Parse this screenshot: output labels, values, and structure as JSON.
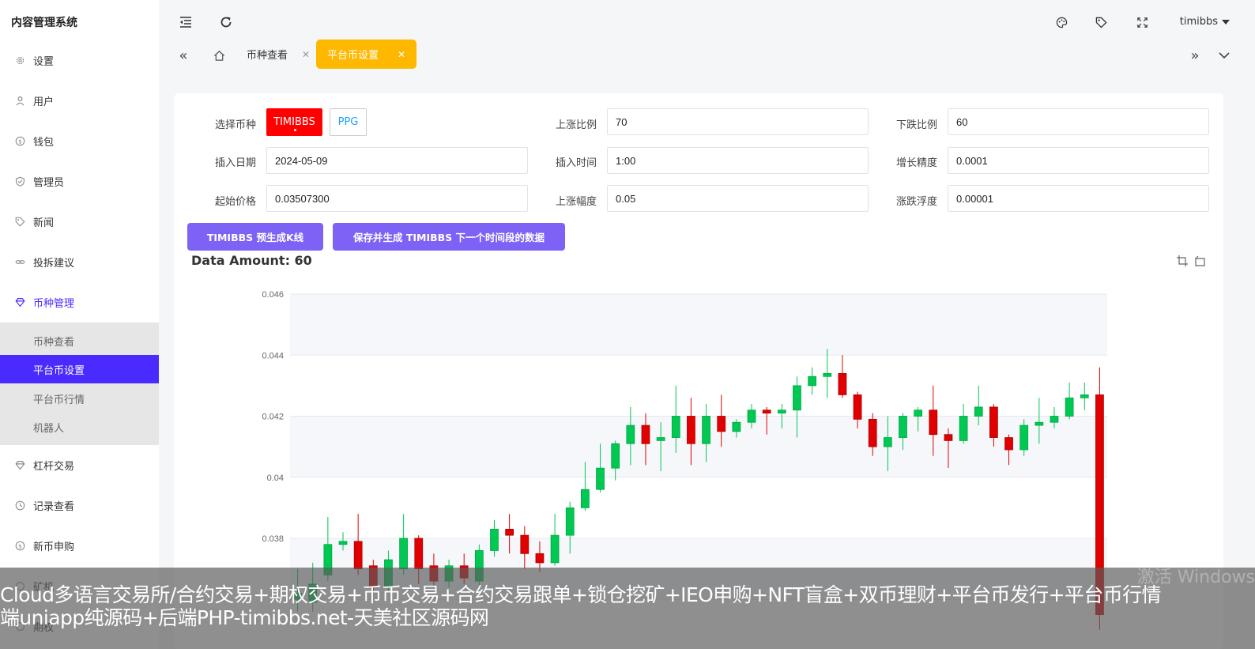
{
  "app": {
    "title": "内容管理系统"
  },
  "sidebar": {
    "items": [
      {
        "label": "设置",
        "icon": "gear-icon"
      },
      {
        "label": "用户",
        "icon": "user-icon"
      },
      {
        "label": "钱包",
        "icon": "dollar-icon"
      },
      {
        "label": "管理员",
        "icon": "shield-check-icon"
      },
      {
        "label": "新闻",
        "icon": "tag-icon"
      },
      {
        "label": "投拆建议",
        "icon": "link-icon"
      },
      {
        "label": "币种管理",
        "icon": "diamond-icon"
      },
      {
        "label": "杠杆交易",
        "icon": "diamond-icon"
      },
      {
        "label": "记录查看",
        "icon": "clock-icon"
      },
      {
        "label": "新币申购",
        "icon": "dollar-icon"
      },
      {
        "label": "矿机",
        "icon": "circle-icon"
      },
      {
        "label": "期权",
        "icon": "circle-icon"
      }
    ],
    "submenu": [
      {
        "label": "币种查看"
      },
      {
        "label": "平台币设置"
      },
      {
        "label": "平台币行情"
      },
      {
        "label": "机器人"
      }
    ]
  },
  "header": {
    "username": "timibbs"
  },
  "tabs": [
    {
      "label": "币种查看"
    },
    {
      "label": "平台币设置"
    }
  ],
  "form": {
    "select_coin_label": "选择币种",
    "coins": [
      "TIMIBBS",
      "PPG"
    ],
    "rise_ratio_label": "上涨比例",
    "rise_ratio": "70",
    "fall_ratio_label": "下跌比例",
    "fall_ratio": "60",
    "insert_date_label": "插入日期",
    "insert_date": "2024-05-09",
    "insert_time_label": "插入时间",
    "insert_time": "1:00",
    "growth_precision_label": "增长精度",
    "growth_precision": "0.0001",
    "start_price_label": "起始价格",
    "start_price": "0.03507300",
    "rise_amplitude_label": "上涨幅度",
    "rise_amplitude": "0.05",
    "fluctuation_label": "涨跌浮度",
    "fluctuation": "0.00001"
  },
  "actions": {
    "generate_kline": "TIMIBBS 预生成K线",
    "save_generate": "保存并生成 TIMIBBS 下一个时间段的数据"
  },
  "chart_title": "Data Amount: 60",
  "chart_data": {
    "type": "candlestick",
    "ylim": [
      0.0355,
      0.046
    ],
    "yticks": [
      "0.046",
      "0.044",
      "0.042",
      "0.04",
      "0.038"
    ],
    "up_color": "#00c853",
    "down_color": "#e00000",
    "candles": [
      {
        "o": 0.036,
        "c": 0.0362,
        "l": 0.0356,
        "h": 0.037
      },
      {
        "o": 0.0359,
        "c": 0.0365,
        "l": 0.0356,
        "h": 0.0372
      },
      {
        "o": 0.0368,
        "c": 0.0378,
        "l": 0.0366,
        "h": 0.0387
      },
      {
        "o": 0.0378,
        "c": 0.0379,
        "l": 0.0376,
        "h": 0.0382
      },
      {
        "o": 0.0379,
        "c": 0.037,
        "l": 0.0368,
        "h": 0.0388
      },
      {
        "o": 0.0371,
        "c": 0.0364,
        "l": 0.0362,
        "h": 0.0373
      },
      {
        "o": 0.0364,
        "c": 0.0373,
        "l": 0.0362,
        "h": 0.0376
      },
      {
        "o": 0.037,
        "c": 0.038,
        "l": 0.0368,
        "h": 0.0388
      },
      {
        "o": 0.038,
        "c": 0.037,
        "l": 0.0365,
        "h": 0.0381
      },
      {
        "o": 0.0371,
        "c": 0.0366,
        "l": 0.0364,
        "h": 0.0375
      },
      {
        "o": 0.0366,
        "c": 0.0371,
        "l": 0.0364,
        "h": 0.0373
      },
      {
        "o": 0.0371,
        "c": 0.0367,
        "l": 0.0365,
        "h": 0.0375
      },
      {
        "o": 0.0366,
        "c": 0.0376,
        "l": 0.0364,
        "h": 0.0378
      },
      {
        "o": 0.0376,
        "c": 0.0383,
        "l": 0.0374,
        "h": 0.0386
      },
      {
        "o": 0.0383,
        "c": 0.0381,
        "l": 0.0375,
        "h": 0.0388
      },
      {
        "o": 0.0381,
        "c": 0.0375,
        "l": 0.037,
        "h": 0.0384
      },
      {
        "o": 0.0375,
        "c": 0.0372,
        "l": 0.0369,
        "h": 0.0379
      },
      {
        "o": 0.0372,
        "c": 0.0381,
        "l": 0.0371,
        "h": 0.0388
      },
      {
        "o": 0.0381,
        "c": 0.039,
        "l": 0.0375,
        "h": 0.0392
      },
      {
        "o": 0.039,
        "c": 0.0396,
        "l": 0.0389,
        "h": 0.0405
      },
      {
        "o": 0.0396,
        "c": 0.0403,
        "l": 0.0395,
        "h": 0.0411
      },
      {
        "o": 0.0403,
        "c": 0.0411,
        "l": 0.0399,
        "h": 0.0412
      },
      {
        "o": 0.0411,
        "c": 0.0417,
        "l": 0.0404,
        "h": 0.0423
      },
      {
        "o": 0.0417,
        "c": 0.0411,
        "l": 0.0404,
        "h": 0.0421
      },
      {
        "o": 0.0412,
        "c": 0.0413,
        "l": 0.0402,
        "h": 0.0418
      },
      {
        "o": 0.0413,
        "c": 0.042,
        "l": 0.0408,
        "h": 0.043
      },
      {
        "o": 0.042,
        "c": 0.0411,
        "l": 0.0404,
        "h": 0.0426
      },
      {
        "o": 0.0411,
        "c": 0.042,
        "l": 0.0405,
        "h": 0.0424
      },
      {
        "o": 0.042,
        "c": 0.0415,
        "l": 0.041,
        "h": 0.0427
      },
      {
        "o": 0.0415,
        "c": 0.0418,
        "l": 0.0413,
        "h": 0.0419
      },
      {
        "o": 0.0418,
        "c": 0.0422,
        "l": 0.0416,
        "h": 0.0424
      },
      {
        "o": 0.0422,
        "c": 0.0421,
        "l": 0.0414,
        "h": 0.0423
      },
      {
        "o": 0.0421,
        "c": 0.0422,
        "l": 0.0416,
        "h": 0.0424
      },
      {
        "o": 0.0422,
        "c": 0.043,
        "l": 0.0413,
        "h": 0.0433
      },
      {
        "o": 0.043,
        "c": 0.0433,
        "l": 0.0427,
        "h": 0.0436
      },
      {
        "o": 0.0433,
        "c": 0.0434,
        "l": 0.0426,
        "h": 0.0442
      },
      {
        "o": 0.0434,
        "c": 0.0427,
        "l": 0.0426,
        "h": 0.044
      },
      {
        "o": 0.0427,
        "c": 0.0419,
        "l": 0.0416,
        "h": 0.0428
      },
      {
        "o": 0.0419,
        "c": 0.041,
        "l": 0.0407,
        "h": 0.0421
      },
      {
        "o": 0.041,
        "c": 0.0413,
        "l": 0.0402,
        "h": 0.042
      },
      {
        "o": 0.0413,
        "c": 0.042,
        "l": 0.0409,
        "h": 0.0421
      },
      {
        "o": 0.042,
        "c": 0.0422,
        "l": 0.0415,
        "h": 0.0423
      },
      {
        "o": 0.0422,
        "c": 0.0414,
        "l": 0.0407,
        "h": 0.043
      },
      {
        "o": 0.0414,
        "c": 0.0412,
        "l": 0.0403,
        "h": 0.0416
      },
      {
        "o": 0.0412,
        "c": 0.042,
        "l": 0.0411,
        "h": 0.0424
      },
      {
        "o": 0.042,
        "c": 0.0423,
        "l": 0.0417,
        "h": 0.043
      },
      {
        "o": 0.0423,
        "c": 0.0413,
        "l": 0.041,
        "h": 0.0424
      },
      {
        "o": 0.0413,
        "c": 0.0409,
        "l": 0.0404,
        "h": 0.0414
      },
      {
        "o": 0.0409,
        "c": 0.0417,
        "l": 0.0407,
        "h": 0.0419
      },
      {
        "o": 0.0417,
        "c": 0.0418,
        "l": 0.0411,
        "h": 0.0426
      },
      {
        "o": 0.0418,
        "c": 0.042,
        "l": 0.0416,
        "h": 0.0423
      },
      {
        "o": 0.042,
        "c": 0.0426,
        "l": 0.0419,
        "h": 0.0431
      },
      {
        "o": 0.0426,
        "c": 0.0427,
        "l": 0.0422,
        "h": 0.0431
      },
      {
        "o": 0.0427,
        "c": 0.0355,
        "l": 0.035,
        "h": 0.0436
      }
    ]
  },
  "overlay": {
    "banner": "Cloud多语言交易所/合约交易+期权交易+币币交易+合约交易跟单+锁仓挖矿+IEO申购+NFT盲盒+双币理财+平台币发行+平台币行情\n端uniapp纯源码+后端PHP-timibbs.net-天美社区源码网",
    "watermark": "激活 Windows"
  }
}
